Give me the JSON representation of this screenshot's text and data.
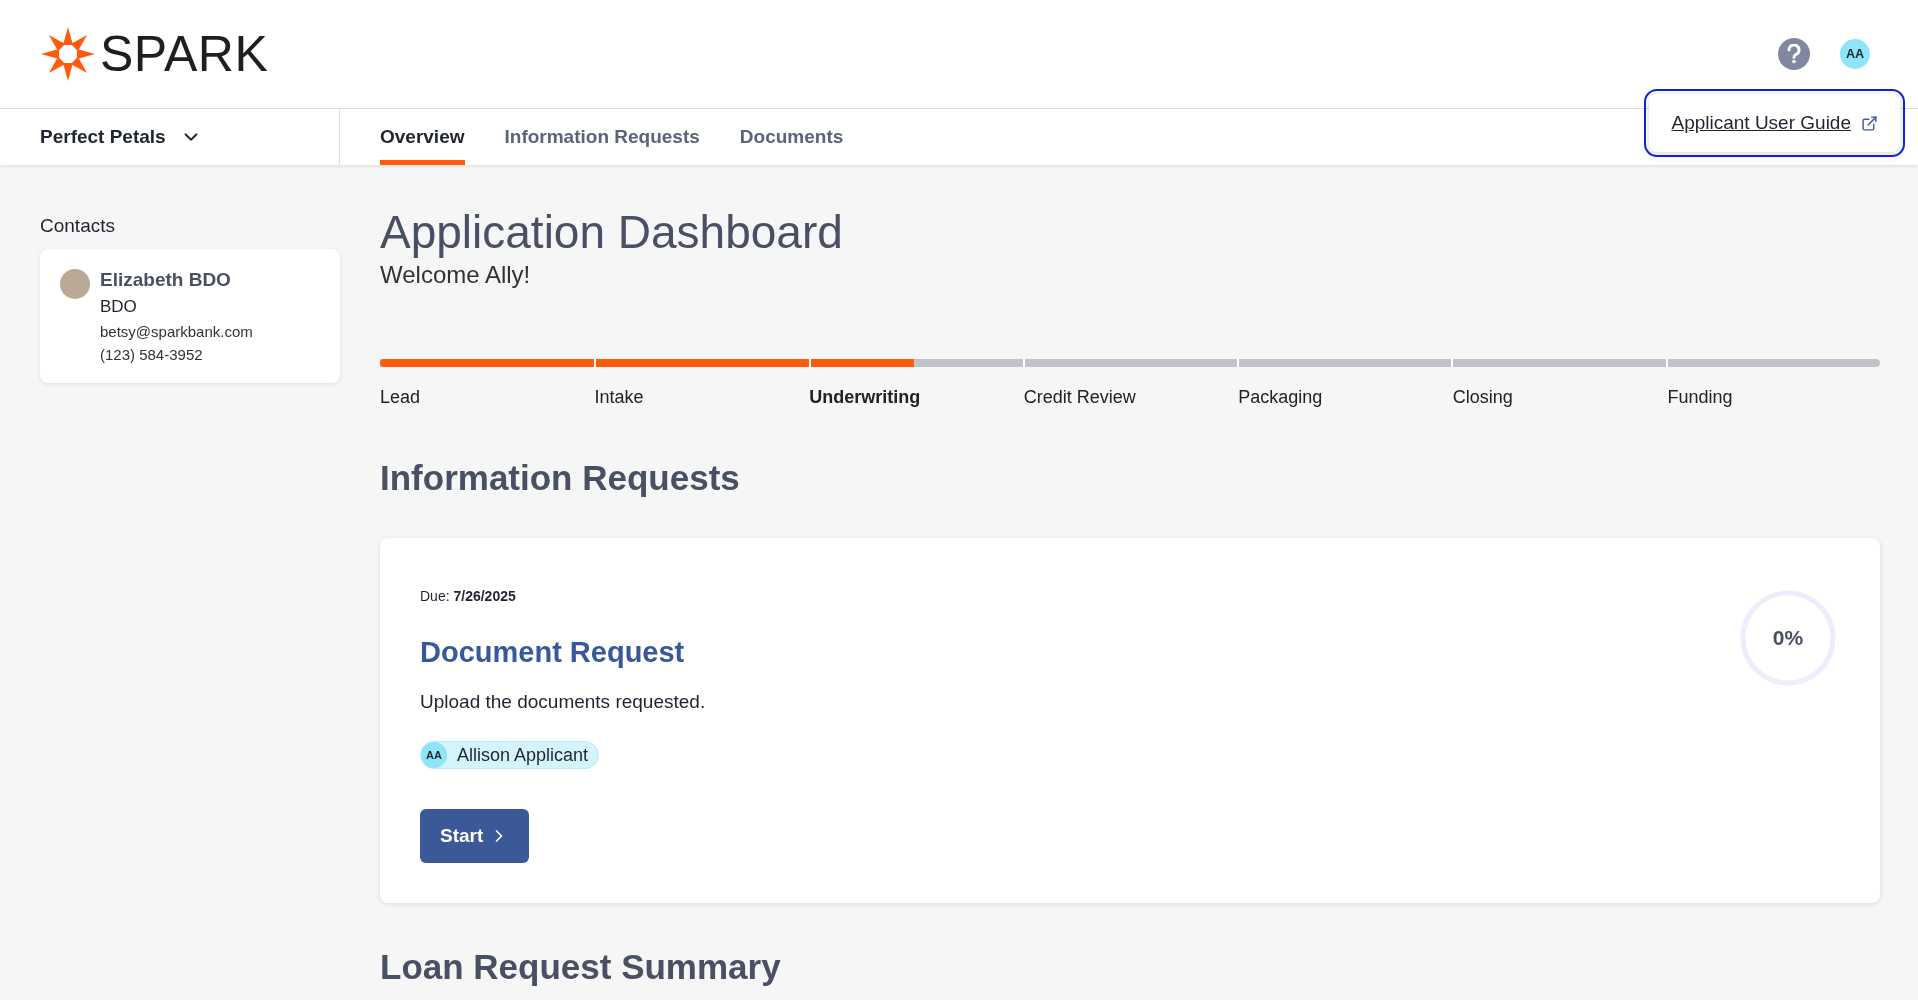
{
  "header": {
    "logo": "SPARK",
    "avatar": "AA",
    "help_menu": {
      "link": "Applicant User Guide"
    }
  },
  "business_selector": {
    "label": "Perfect Petals"
  },
  "tabs": [
    {
      "label": "Overview",
      "selected": true
    },
    {
      "label": "Information Requests",
      "selected": false
    },
    {
      "label": "Documents",
      "selected": false
    }
  ],
  "sidebar": {
    "title": "Contacts",
    "contacts": [
      {
        "name": "Elizabeth BDO",
        "role": "BDO",
        "email": "betsy@sparkbank.com",
        "phone": "(123) 584-3952"
      }
    ]
  },
  "dashboard": {
    "title": "Application Dashboard",
    "welcome": "Welcome Ally!"
  },
  "stage_progress": {
    "level": 0.356
  },
  "stages": [
    {
      "label": "Lead",
      "selected": false
    },
    {
      "label": "Intake",
      "selected": false
    },
    {
      "label": "Underwriting",
      "selected": true
    },
    {
      "label": "Credit Review",
      "selected": false
    },
    {
      "label": "Packaging",
      "selected": false
    },
    {
      "label": "Closing",
      "selected": false
    },
    {
      "label": "Funding",
      "selected": false
    }
  ],
  "information_requests": {
    "heading": "Information Requests",
    "requests": [
      {
        "due": "Due: **7/26/2025**",
        "title": "Document Request",
        "description": "Upload the documents requested.",
        "assignee": {
          "initials": "AA",
          "name": "Allison Applicant"
        },
        "button": "Start",
        "progress": {
          "label": "0%",
          "level": 0
        }
      }
    ]
  },
  "loan_summary": {
    "heading": "Loan Request Summary"
  }
}
